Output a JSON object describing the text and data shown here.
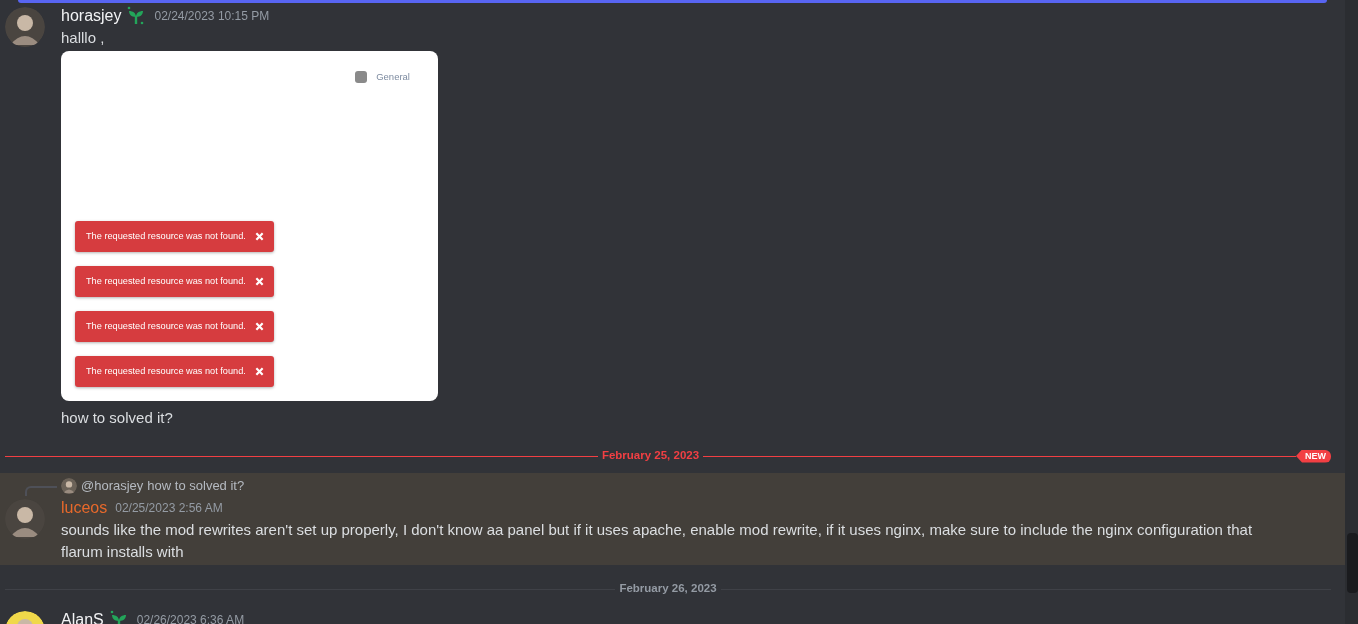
{
  "feed": [
    {
      "kind": "message",
      "author": "horasjey",
      "color": "#f2f3f5",
      "badge": true,
      "highlighted": false,
      "timestamp": "02/24/2023 10:15 PM",
      "content": [
        {
          "kind": "text",
          "text": "halllo ,"
        },
        {
          "kind": "image",
          "legend": "General",
          "toasts": [
            "The requested resource was not found.",
            "The requested resource was not found.",
            "The requested resource was not found.",
            "The requested resource was not found."
          ]
        },
        {
          "kind": "text",
          "text": "how to solved it?"
        }
      ]
    },
    {
      "kind": "divider",
      "label": "February 25, 2023",
      "new": true,
      "badge": "NEW"
    },
    {
      "kind": "message",
      "author": "luceos",
      "color": "#e8692b",
      "badge": false,
      "highlighted": true,
      "reply": {
        "mention": "@horasjey",
        "text": "how to solved it?"
      },
      "timestamp": "02/25/2023 2:56 AM",
      "content": [
        {
          "kind": "text",
          "text": "sounds like the mod rewrites aren't set up properly, I don't know aa panel but if it uses apache, enable mod rewrite, if it uses nginx, make sure to include the nginx configuration that flarum installs with"
        }
      ]
    },
    {
      "kind": "divider",
      "label": "February 26, 2023",
      "new": false
    },
    {
      "kind": "message",
      "author": "AlanS",
      "color": "#f2f3f5",
      "badge": true,
      "highlighted": false,
      "timestamp": "02/26/2023 6:36 AM"
    }
  ]
}
